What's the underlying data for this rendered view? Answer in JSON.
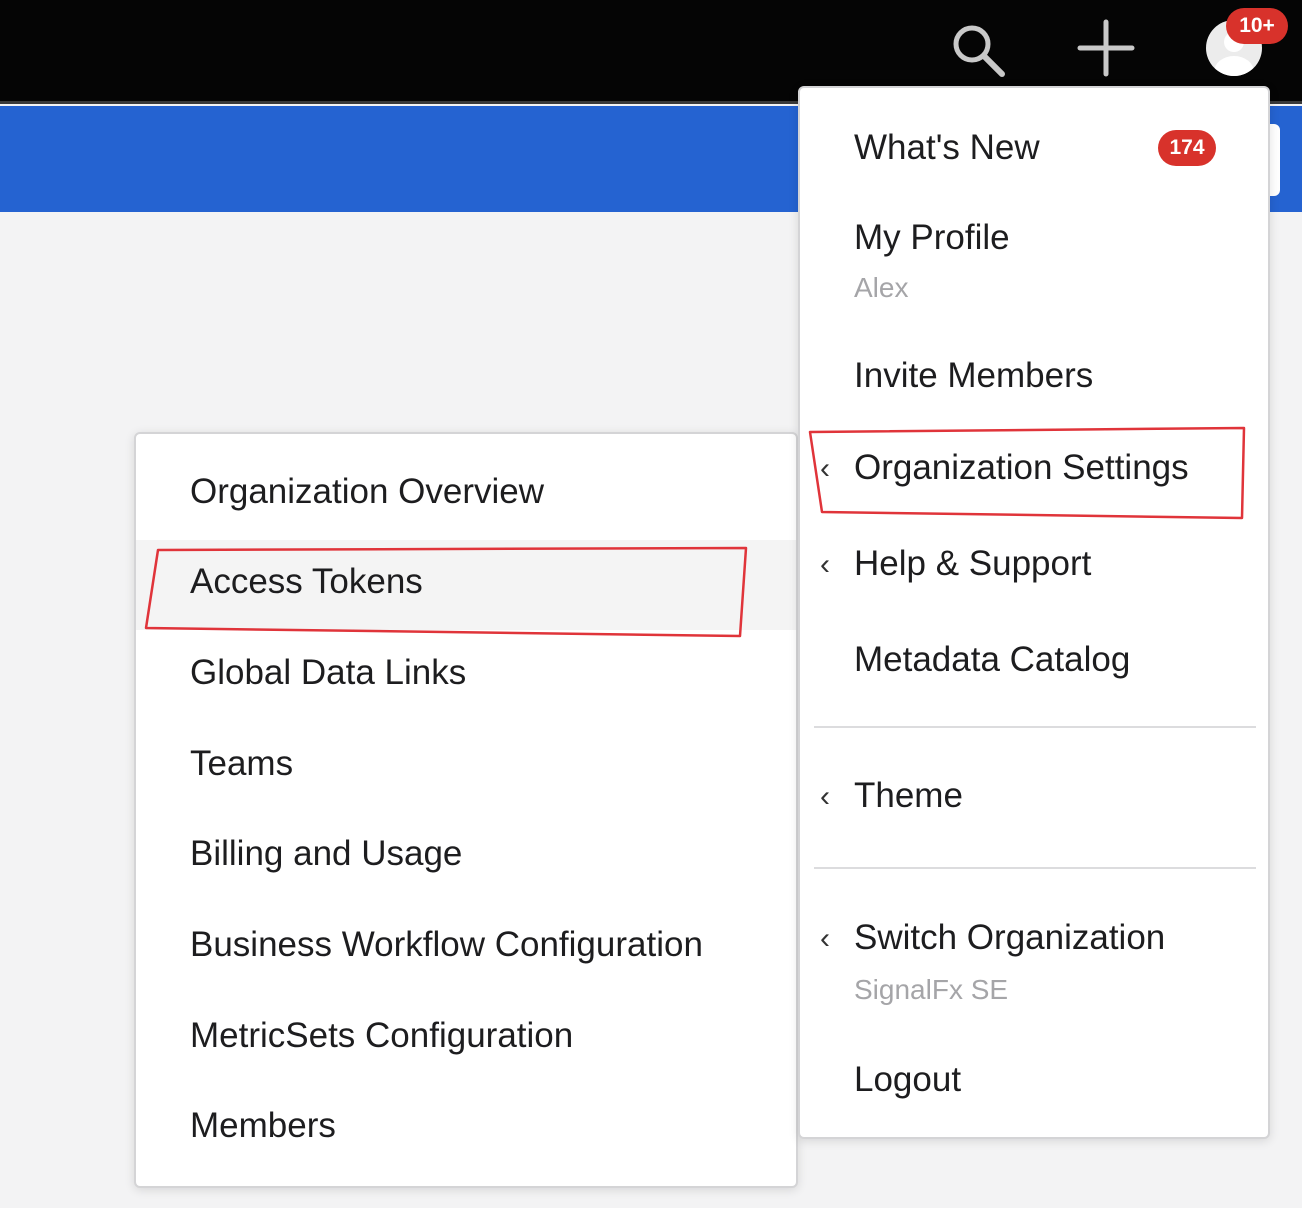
{
  "header": {
    "search_icon": "search-icon",
    "add_icon": "plus-icon",
    "avatar_icon": "user-avatar-icon",
    "notification_badge": "10+"
  },
  "user_menu": {
    "items": [
      {
        "label": "What's New",
        "badge": "174"
      },
      {
        "label": "My Profile",
        "sublabel": "Alex"
      },
      {
        "label": "Invite Members"
      },
      {
        "label": "Organization Settings",
        "has_submenu": true,
        "highlighted": true
      },
      {
        "label": "Help & Support",
        "has_submenu": true
      },
      {
        "label": "Metadata Catalog"
      },
      {
        "label": "Theme",
        "has_submenu": true
      },
      {
        "label": "Switch Organization",
        "sublabel": "SignalFx SE",
        "has_submenu": true
      },
      {
        "label": "Logout"
      }
    ]
  },
  "org_settings_submenu": {
    "items": [
      {
        "label": "Organization Overview"
      },
      {
        "label": "Access Tokens",
        "highlighted": true
      },
      {
        "label": "Global Data Links"
      },
      {
        "label": "Teams"
      },
      {
        "label": "Billing and Usage"
      },
      {
        "label": "Business Workflow Configuration"
      },
      {
        "label": "MetricSets Configuration"
      },
      {
        "label": "Members"
      }
    ]
  },
  "colors": {
    "topbar": "#050505",
    "banner": "#2563d1",
    "badge": "#d8322b",
    "annotation": "#e0343a"
  }
}
